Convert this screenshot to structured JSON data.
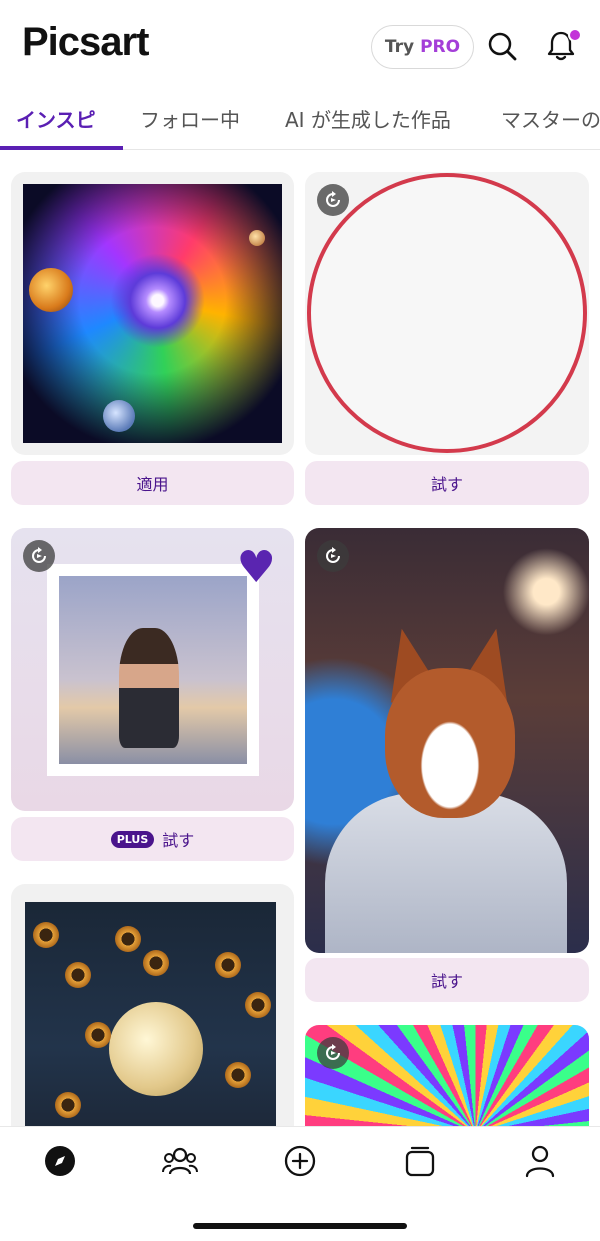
{
  "header": {
    "logo": "Picsart",
    "try_label": "Try",
    "pro_label": "PRO"
  },
  "tabs": [
    {
      "label": "インスピ",
      "active": true
    },
    {
      "label": "フォロー中",
      "active": false
    },
    {
      "label": "AI が生成した作品",
      "active": false
    },
    {
      "label": "マスターの",
      "active": false
    }
  ],
  "feed": {
    "cards": [
      {
        "image": "cosmic-spiral-art",
        "action": "適用",
        "plus": false
      },
      {
        "image": "loading-placeholder-circle",
        "action": "試す",
        "plus": false,
        "replay": true
      },
      {
        "image": "polaroid-girl-photo",
        "action": "試す",
        "plus": true,
        "plus_label": "PLUS",
        "replay": true
      },
      {
        "image": "corgi-astronaut",
        "action": "試す",
        "plus": false,
        "replay": true
      },
      {
        "image": "moon-sunflowers",
        "action": null,
        "plus": false
      },
      {
        "image": "psychedelic-portrait",
        "action": null,
        "plus": false,
        "replay": true
      }
    ]
  },
  "bottom_nav": {
    "items": [
      "explore-icon",
      "community-icon",
      "create-icon",
      "projects-icon",
      "profile-icon"
    ]
  },
  "colors": {
    "accent": "#5a1fb3",
    "pro": "#a43ed8",
    "action_bg": "#f3e6f1",
    "action_text": "#4a148c",
    "notification_dot": "#c332d8",
    "placeholder_ring": "#d33a4c"
  }
}
